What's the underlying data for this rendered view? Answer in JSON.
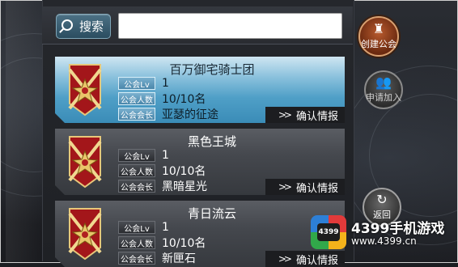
{
  "search": {
    "button_label": "搜索",
    "placeholder": ""
  },
  "guilds": [
    {
      "name": "百万御宅骑士团",
      "labels": [
        "公会Lv",
        "公会人数",
        "公会会长"
      ],
      "level": "1",
      "members": "10/10名",
      "leader": "亚瑟的征途",
      "confirm": "确认情报",
      "selected": true
    },
    {
      "name": "黑色王城",
      "labels": [
        "公会Lv",
        "公会人数",
        "公会会长"
      ],
      "level": "1",
      "members": "10/10名",
      "leader": "黑暗星光",
      "confirm": "确认情报",
      "selected": false
    },
    {
      "name": "青日流云",
      "labels": [
        "公会Lv",
        "公会人数",
        "公会会长"
      ],
      "level": "1",
      "members": "10/10名",
      "leader": "新匣石",
      "confirm": "确认情报",
      "selected": false
    }
  ],
  "side_buttons": {
    "create": "创建公会",
    "join": "申请加入",
    "back": "返回"
  },
  "icons": {
    "create": "castle-icon",
    "join": "people-icon",
    "back": "refresh-arrow-icon",
    "search": "search-icon",
    "emblem": "crossed-swords-emblem-icon"
  },
  "watermark": {
    "logo_text": "4399",
    "title": "4399手机游戏",
    "url": "www.4399.cn"
  },
  "colors": {
    "selected_row": "#4f9fc7",
    "search_button": "#3b6176",
    "create_button": "#8a3d1a"
  }
}
